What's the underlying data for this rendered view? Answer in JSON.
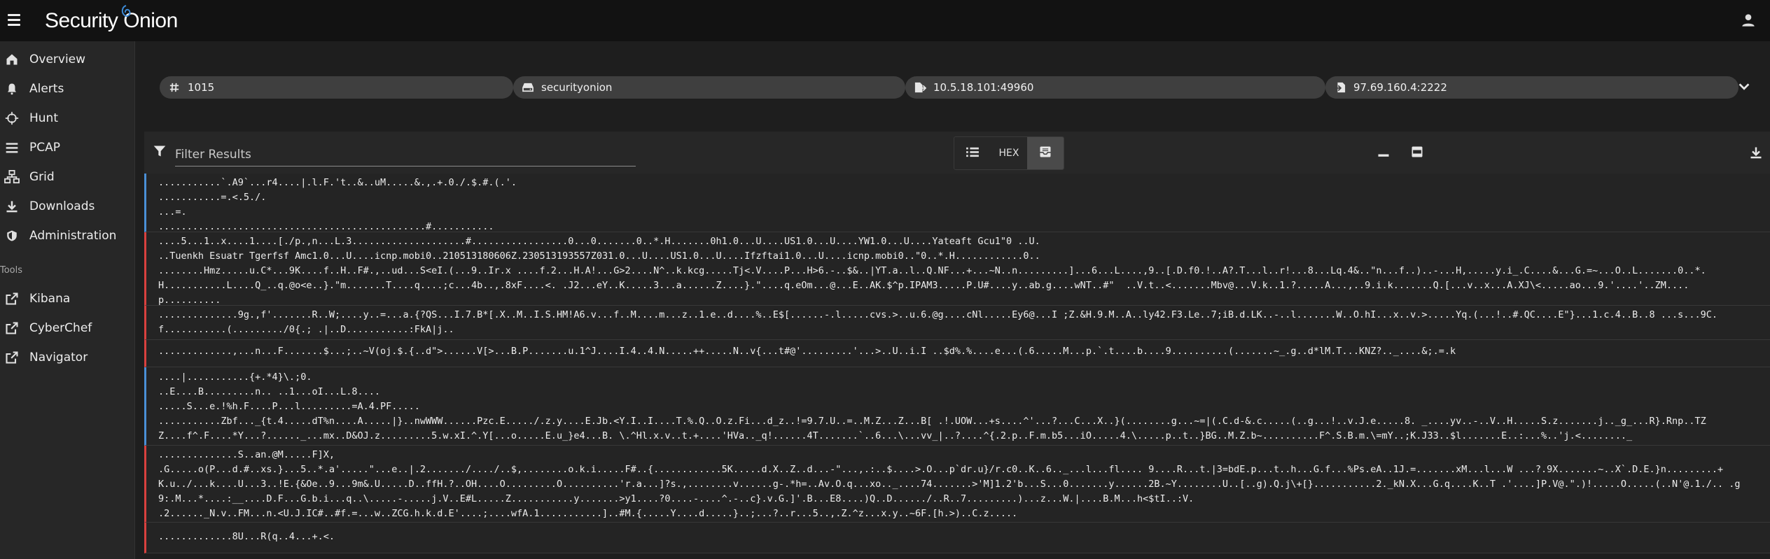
{
  "topbar": {
    "logo_text": "Security Onion",
    "menu_icon": "menu-icon",
    "user_icon": "account-icon"
  },
  "sidebar": {
    "items": [
      {
        "label": "Overview",
        "icon": "home-icon"
      },
      {
        "label": "Alerts",
        "icon": "bell-icon"
      },
      {
        "label": "Hunt",
        "icon": "crosshairs-icon"
      },
      {
        "label": "PCAP",
        "icon": "list-icon"
      },
      {
        "label": "Grid",
        "icon": "grid-icon"
      },
      {
        "label": "Downloads",
        "icon": "download-icon"
      },
      {
        "label": "Administration",
        "icon": "shield-icon"
      }
    ],
    "tools_header": "Tools",
    "tools": [
      {
        "label": "Kibana",
        "icon": "external-link-icon"
      },
      {
        "label": "CyberChef",
        "icon": "external-link-icon"
      },
      {
        "label": "Navigator",
        "icon": "external-link-icon"
      }
    ]
  },
  "chips": {
    "job_id": "1015",
    "sensor": "securityonion",
    "source": "10.5.18.101:49960",
    "destination": "97.69.160.4:2222"
  },
  "toolbar": {
    "filter_placeholder": "Filter Results",
    "hex_label": "HEX"
  },
  "colors": {
    "client_bar": "#4a8fd6",
    "server_bar": "#d9413f",
    "active_toggle": "#4a4a4a"
  },
  "packets": [
    {
      "direction": "client",
      "lines": [
        "...........`.A9`...r4....|.l.F.'t..&..uM.....&.,.+.0./.$.#.(.'.",
        "...........=.<.5./.",
        "...=.",
        "...............................................#..........."
      ]
    },
    {
      "direction": "server",
      "lines": [
        "....5...1..x....1....[./p.,n...L.3....................#.................0...0.......0..*.H.......0h1.0...U....US1.0...U....YW1.0...U....Yateaft Gcu1\"0 ..U.",
        "..Tuenkh Esuatr Tgerfsf Amc1.0...U....icnp.mobi0..210513180606Z.230513193557Z031.0...U....US1.0...U....Ifzftai1.0...U....icnp.mobi0..\"0..*.H............0..",
        "........Hmz.....u.C*...9K....f..H..F#.,..ud...S<eI.(...9..Ir.x ....f.2...H.A!...G>2....N^..k.kcg.....Tj<.V....P...H>6.-..$&..|YT.a..l..Q.NF...+...~N..n.........]...6...L....,9..[.D.f0.!..A?.T...l..r!...8...Lq.4&..\"n...f..)..-...H,.....y.i_.C....&...G.=~...O..L.......0..*.",
        "H...........L....Q_..q.@o<e..}.\"m.......T....q....;c...4b..,.8xF....<. .J2...eY..K.....3...a......Z....}.\"....q.eOm...@...E..AK.$^p.IPAM3.....P.U#....y..ab.g....wNT..#\"  ..V.t..<.......Mbv@...V.k..1.?.....A...,..9.i.k.......Q.[...v..x...A.XJ\\<.....ao...9.'....'..ZM....",
        "p.........."
      ]
    },
    {
      "direction": "server",
      "lines": [
        "..............9g.,f'.......R..W;....y..=...a.{?QS...I.7.B*[.X..M..I.S.HM!A6.v...f..M....m...z..1.e..d....%..E$[......-.l.....cvs.>..u.6.@g....cNl.....Ey6@...I ;Z.&H.9.M..A..ly42.F3.Le..7;iB.d.LK..-..l.......W..O.hI...x..v.>.....Yq.(...!..#.QC....E\"}...1.c.4..B..8 ...s...9C.",
        "f...........(........./0{.; .|..D...........:FkA|j.."
      ]
    },
    {
      "direction": "server",
      "lines": [
        ".............,...n...F.......$...;..~V(oj.$.{..d\">......V[>...B.P.......u.1^J....I.4..4.N.....++.....N..v{...t#@'.........'...>..U..i.I ..$d%.%....e...(.6.....M...p.`.t....b....9..........(.......~_.g..d*lM.T...KNZ?.._....&;.=.k"
      ]
    },
    {
      "direction": "client",
      "lines": [
        "....|...........{+.*4}\\.;0.",
        "..E....B.........n.. ..1...oI...L.8....",
        ".....S...e.!%h.F....P...l.........=A.4.PF.....",
        "...........Zbf..._{t.4.....dT%n....A.....|}..nwWWW......Pzc.E...../.z.y....E.Jb.<Y.I..I....T.%.Q..O.z.Fi...d_z..!=9.7.U..=..M.Z...Z...B[ .!.UOW...+s....^'...?...C...X..}(........g...~=|(.C.d-&.c.....(..g...!..v.J.e.....8. _....yv..-..V..H.....S.z.......j.._g_...R}.Rnp..TZ",
        "Z....f^.F....*Y...?......_...mx..D&OJ.z.........5.w.xI.^.Y[...o.....E.u_}e4...B. \\.^Hl.x.v..t.+....'HVa.._q!......4T.......`..6...\\...vv_|..?....^{.2.p..F.m.b5...iO.....4.\\.....p..t..}BG..M.Z.b~..........F^.S.B.m.\\=mY..;K.J33..$l.......E..:...%..'j.<........_"
      ]
    },
    {
      "direction": "server",
      "lines": [
        "..............S..an.@M.....F]X,",
        ".G.....o(P...d.#..xs.}...5..*.a'.....\"...e..|.2......./..../..$,........o.k.i.....F#..{............5K.....d.X..Z..d...-\"...,.:..$....>.O...p`dr.u}/r.c0..K..6.._...l...fl.... 9....R...t.|3=bdE.p...t..h...G.f...%Ps.eA..1J.=.......xM...l...W ...?.9X.......~..X`.D.E.}n.........+",
        "K.u../...k....U...3..!E.{&Oe..9...9m&.U.....D..ffH.?..OH....O.........O..........'r.a...]?s.,........v......g-.*h=..Av.O.q...xo.._....74.......>'M]1.2'b...S...0.......y......2B.~Y........U..[..g).Q.j\\+[}...........2._kN.X...G.q....K..T .'....]P.V@.\".)!.....O.....(..N'@.1./.. .g",
        "9:.M...*....:__....D.F...G.b.i...q..\\.....-.....j.V..E#L.....Z...........y.......>y1....?0....-....^.-..c}.v.G.]'.B...E8....)Q..D....../..R..7.........)...z...W.|....B.M...h<$tI..:V.",
        ".2......_N.v..FM...n.<U.J.IC#..#f.=...w..ZCG.h.k.d.E'....;....wfA.1...........]..#M.{.....Y....d.....}..;...?..r...5..,.Z.^z...x.y..~6F.[h.>)..C.z....."
      ]
    },
    {
      "direction": "server",
      "lines": [
        ".............8U...R(q..4...+.<."
      ]
    }
  ]
}
